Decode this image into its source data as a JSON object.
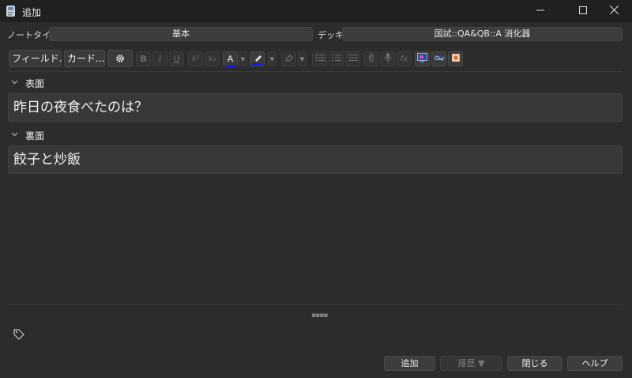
{
  "window": {
    "title": "追加"
  },
  "note_type": {
    "label": "ノートタイプ",
    "value": "基本"
  },
  "deck": {
    "label": "デッキ",
    "value": "国試::QA&QB::A 消化器"
  },
  "toolbar": {
    "fields_button": "フィールド...",
    "cards_button": "カード..."
  },
  "fields": [
    {
      "name": "表面",
      "value": "昨日の夜食べたのは？"
    },
    {
      "name": "裏面",
      "value": "餃子と炒飯"
    }
  ],
  "buttons": {
    "add": "追加",
    "history": "履歴 ▼",
    "close": "閉じる",
    "help": "ヘルプ"
  },
  "colors": {
    "text_color_underline": "#1a1adb",
    "highlight_underline": "#1a1adb"
  }
}
